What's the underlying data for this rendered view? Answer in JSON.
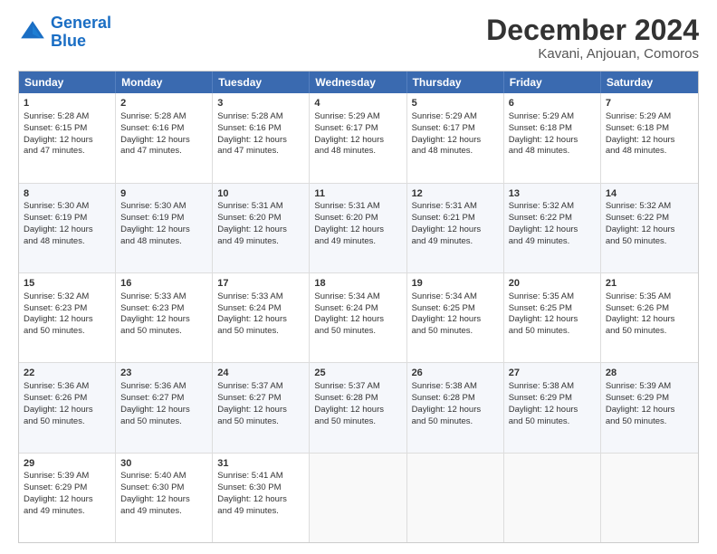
{
  "logo": {
    "line1": "General",
    "line2": "Blue"
  },
  "title": "December 2024",
  "subtitle": "Kavani, Anjouan, Comoros",
  "weekdays": [
    "Sunday",
    "Monday",
    "Tuesday",
    "Wednesday",
    "Thursday",
    "Friday",
    "Saturday"
  ],
  "weeks": [
    [
      {
        "day": "1",
        "lines": [
          "Sunrise: 5:28 AM",
          "Sunset: 6:15 PM",
          "Daylight: 12 hours",
          "and 47 minutes."
        ]
      },
      {
        "day": "2",
        "lines": [
          "Sunrise: 5:28 AM",
          "Sunset: 6:16 PM",
          "Daylight: 12 hours",
          "and 47 minutes."
        ]
      },
      {
        "day": "3",
        "lines": [
          "Sunrise: 5:28 AM",
          "Sunset: 6:16 PM",
          "Daylight: 12 hours",
          "and 47 minutes."
        ]
      },
      {
        "day": "4",
        "lines": [
          "Sunrise: 5:29 AM",
          "Sunset: 6:17 PM",
          "Daylight: 12 hours",
          "and 48 minutes."
        ]
      },
      {
        "day": "5",
        "lines": [
          "Sunrise: 5:29 AM",
          "Sunset: 6:17 PM",
          "Daylight: 12 hours",
          "and 48 minutes."
        ]
      },
      {
        "day": "6",
        "lines": [
          "Sunrise: 5:29 AM",
          "Sunset: 6:18 PM",
          "Daylight: 12 hours",
          "and 48 minutes."
        ]
      },
      {
        "day": "7",
        "lines": [
          "Sunrise: 5:29 AM",
          "Sunset: 6:18 PM",
          "Daylight: 12 hours",
          "and 48 minutes."
        ]
      }
    ],
    [
      {
        "day": "8",
        "lines": [
          "Sunrise: 5:30 AM",
          "Sunset: 6:19 PM",
          "Daylight: 12 hours",
          "and 48 minutes."
        ]
      },
      {
        "day": "9",
        "lines": [
          "Sunrise: 5:30 AM",
          "Sunset: 6:19 PM",
          "Daylight: 12 hours",
          "and 48 minutes."
        ]
      },
      {
        "day": "10",
        "lines": [
          "Sunrise: 5:31 AM",
          "Sunset: 6:20 PM",
          "Daylight: 12 hours",
          "and 49 minutes."
        ]
      },
      {
        "day": "11",
        "lines": [
          "Sunrise: 5:31 AM",
          "Sunset: 6:20 PM",
          "Daylight: 12 hours",
          "and 49 minutes."
        ]
      },
      {
        "day": "12",
        "lines": [
          "Sunrise: 5:31 AM",
          "Sunset: 6:21 PM",
          "Daylight: 12 hours",
          "and 49 minutes."
        ]
      },
      {
        "day": "13",
        "lines": [
          "Sunrise: 5:32 AM",
          "Sunset: 6:22 PM",
          "Daylight: 12 hours",
          "and 49 minutes."
        ]
      },
      {
        "day": "14",
        "lines": [
          "Sunrise: 5:32 AM",
          "Sunset: 6:22 PM",
          "Daylight: 12 hours",
          "and 50 minutes."
        ]
      }
    ],
    [
      {
        "day": "15",
        "lines": [
          "Sunrise: 5:32 AM",
          "Sunset: 6:23 PM",
          "Daylight: 12 hours",
          "and 50 minutes."
        ]
      },
      {
        "day": "16",
        "lines": [
          "Sunrise: 5:33 AM",
          "Sunset: 6:23 PM",
          "Daylight: 12 hours",
          "and 50 minutes."
        ]
      },
      {
        "day": "17",
        "lines": [
          "Sunrise: 5:33 AM",
          "Sunset: 6:24 PM",
          "Daylight: 12 hours",
          "and 50 minutes."
        ]
      },
      {
        "day": "18",
        "lines": [
          "Sunrise: 5:34 AM",
          "Sunset: 6:24 PM",
          "Daylight: 12 hours",
          "and 50 minutes."
        ]
      },
      {
        "day": "19",
        "lines": [
          "Sunrise: 5:34 AM",
          "Sunset: 6:25 PM",
          "Daylight: 12 hours",
          "and 50 minutes."
        ]
      },
      {
        "day": "20",
        "lines": [
          "Sunrise: 5:35 AM",
          "Sunset: 6:25 PM",
          "Daylight: 12 hours",
          "and 50 minutes."
        ]
      },
      {
        "day": "21",
        "lines": [
          "Sunrise: 5:35 AM",
          "Sunset: 6:26 PM",
          "Daylight: 12 hours",
          "and 50 minutes."
        ]
      }
    ],
    [
      {
        "day": "22",
        "lines": [
          "Sunrise: 5:36 AM",
          "Sunset: 6:26 PM",
          "Daylight: 12 hours",
          "and 50 minutes."
        ]
      },
      {
        "day": "23",
        "lines": [
          "Sunrise: 5:36 AM",
          "Sunset: 6:27 PM",
          "Daylight: 12 hours",
          "and 50 minutes."
        ]
      },
      {
        "day": "24",
        "lines": [
          "Sunrise: 5:37 AM",
          "Sunset: 6:27 PM",
          "Daylight: 12 hours",
          "and 50 minutes."
        ]
      },
      {
        "day": "25",
        "lines": [
          "Sunrise: 5:37 AM",
          "Sunset: 6:28 PM",
          "Daylight: 12 hours",
          "and 50 minutes."
        ]
      },
      {
        "day": "26",
        "lines": [
          "Sunrise: 5:38 AM",
          "Sunset: 6:28 PM",
          "Daylight: 12 hours",
          "and 50 minutes."
        ]
      },
      {
        "day": "27",
        "lines": [
          "Sunrise: 5:38 AM",
          "Sunset: 6:29 PM",
          "Daylight: 12 hours",
          "and 50 minutes."
        ]
      },
      {
        "day": "28",
        "lines": [
          "Sunrise: 5:39 AM",
          "Sunset: 6:29 PM",
          "Daylight: 12 hours",
          "and 50 minutes."
        ]
      }
    ],
    [
      {
        "day": "29",
        "lines": [
          "Sunrise: 5:39 AM",
          "Sunset: 6:29 PM",
          "Daylight: 12 hours",
          "and 49 minutes."
        ]
      },
      {
        "day": "30",
        "lines": [
          "Sunrise: 5:40 AM",
          "Sunset: 6:30 PM",
          "Daylight: 12 hours",
          "and 49 minutes."
        ]
      },
      {
        "day": "31",
        "lines": [
          "Sunrise: 5:41 AM",
          "Sunset: 6:30 PM",
          "Daylight: 12 hours",
          "and 49 minutes."
        ]
      },
      {
        "day": "",
        "lines": []
      },
      {
        "day": "",
        "lines": []
      },
      {
        "day": "",
        "lines": []
      },
      {
        "day": "",
        "lines": []
      }
    ]
  ]
}
